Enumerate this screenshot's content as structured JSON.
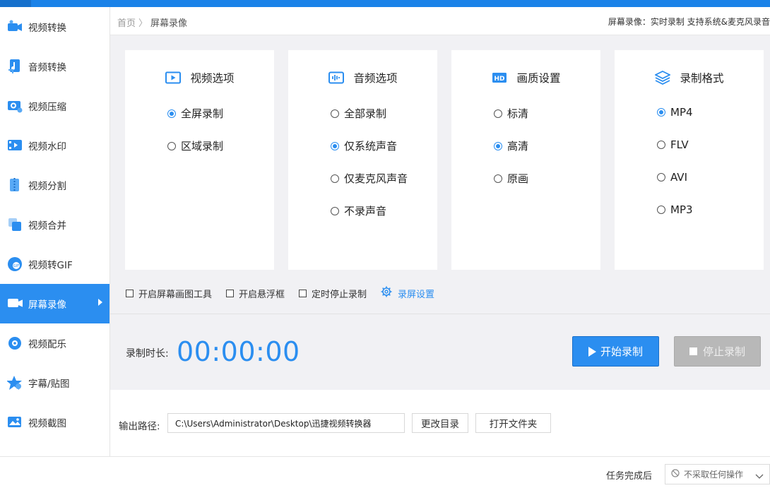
{
  "sidebar": {
    "items": [
      {
        "label": "视频转换",
        "icon": "video-convert-icon"
      },
      {
        "label": "音频转换",
        "icon": "audio-convert-icon"
      },
      {
        "label": "视频压缩",
        "icon": "video-compress-icon"
      },
      {
        "label": "视频水印",
        "icon": "video-watermark-icon"
      },
      {
        "label": "视频分割",
        "icon": "video-split-icon"
      },
      {
        "label": "视频合并",
        "icon": "video-merge-icon"
      },
      {
        "label": "视频转GIF",
        "icon": "gif-icon"
      },
      {
        "label": "屏幕录像",
        "icon": "screen-record-icon",
        "active": true
      },
      {
        "label": "视频配乐",
        "icon": "video-music-icon"
      },
      {
        "label": "字幕/贴图",
        "icon": "subtitle-sticker-icon"
      },
      {
        "label": "视频截图",
        "icon": "video-screenshot-icon"
      }
    ]
  },
  "breadcrumb": {
    "home": "首页",
    "separator": "〉",
    "current": "屏幕录像"
  },
  "header_note": "屏幕录像：实时录制 支持系统&麦克风录音",
  "cards": [
    {
      "title": "视频选项",
      "icon": "video-play-icon",
      "options": [
        {
          "label": "全屏录制",
          "selected": true
        },
        {
          "label": "区域录制",
          "selected": false
        }
      ]
    },
    {
      "title": "音频选项",
      "icon": "audio-wave-icon",
      "options": [
        {
          "label": "全部录制",
          "selected": false
        },
        {
          "label": "仅系统声音",
          "selected": true
        },
        {
          "label": "仅麦克风声音",
          "selected": false
        },
        {
          "label": "不录声音",
          "selected": false
        }
      ]
    },
    {
      "title": "画质设置",
      "icon": "hd-icon",
      "options": [
        {
          "label": "标清",
          "selected": false
        },
        {
          "label": "高清",
          "selected": true
        },
        {
          "label": "原画",
          "selected": false
        }
      ]
    },
    {
      "title": "录制格式",
      "icon": "layers-icon",
      "options": [
        {
          "label": "MP4",
          "selected": true
        },
        {
          "label": "FLV",
          "selected": false
        },
        {
          "label": "AVI",
          "selected": false
        },
        {
          "label": "MP3",
          "selected": false
        }
      ]
    }
  ],
  "checkboxes": [
    {
      "label": "开启屏幕画图工具",
      "checked": false
    },
    {
      "label": "开启悬浮框",
      "checked": false
    },
    {
      "label": "定时停止录制",
      "checked": false
    }
  ],
  "record_settings_link": "录屏设置",
  "duration": {
    "label": "录制时长:",
    "value": "00:00:00"
  },
  "buttons": {
    "start": "开始录制",
    "stop": "停止录制",
    "change_dir": "更改目录",
    "open_folder": "打开文件夹"
  },
  "output": {
    "label": "输出路径:",
    "path": "C:\\Users\\Administrator\\Desktop\\迅捷视频转换器"
  },
  "footer": {
    "label": "任务完成后",
    "select_value": "不采取任何操作"
  },
  "colors": {
    "accent": "#2b8ef0",
    "topbar": "#1a82e8",
    "panel_bg": "#f1f1f4",
    "disabled": "#b8b8b8"
  }
}
